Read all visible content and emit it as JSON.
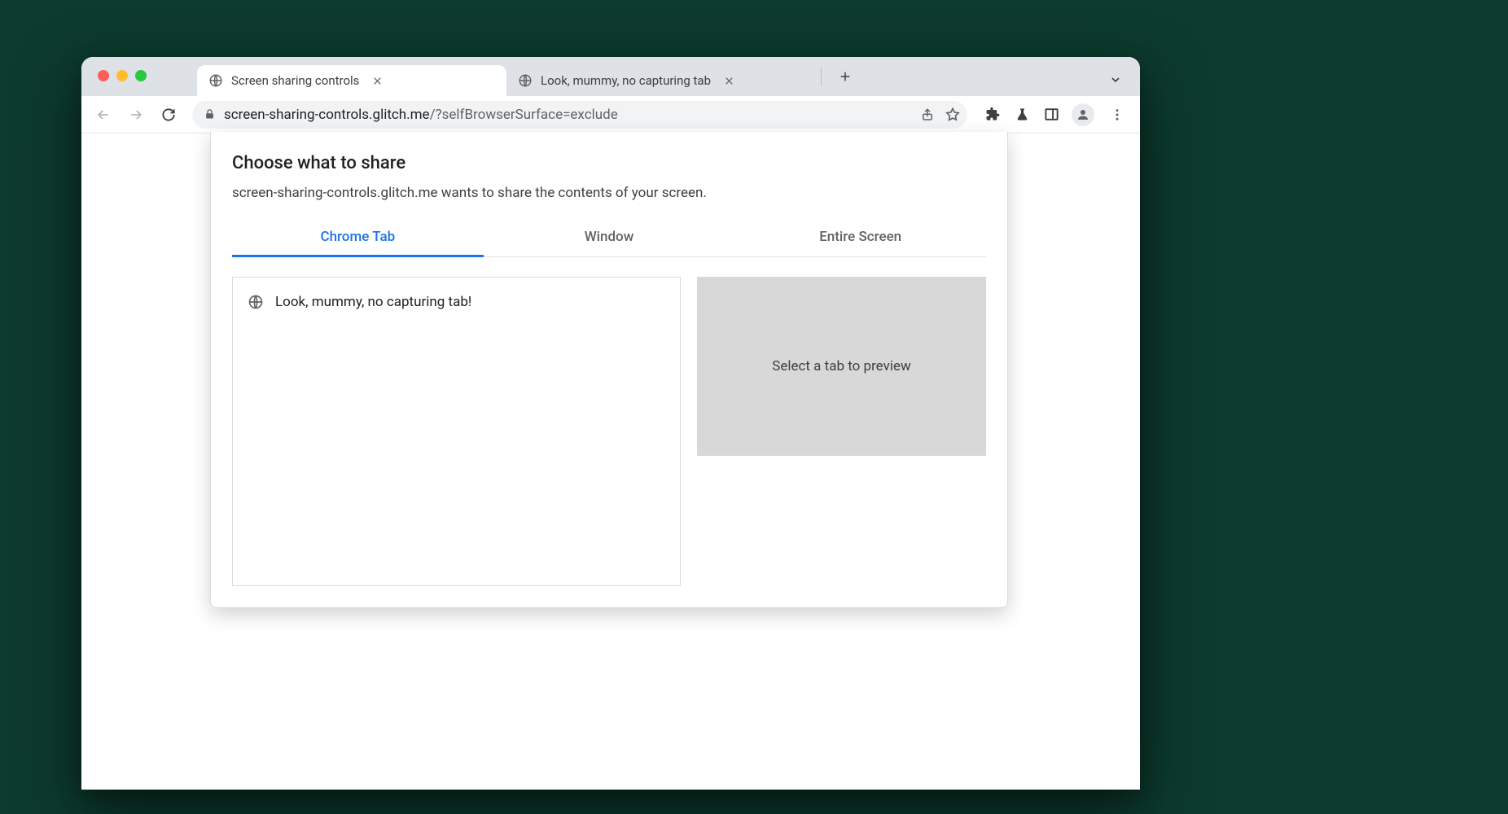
{
  "browser": {
    "tabs": [
      {
        "title": "Screen sharing controls",
        "active": true
      },
      {
        "title": "Look, mummy, no capturing tab",
        "active": false
      }
    ],
    "url_host": "screen-sharing-controls.glitch.me",
    "url_path": "/?selfBrowserSurface=exclude"
  },
  "dialog": {
    "title": "Choose what to share",
    "subtitle": "screen-sharing-controls.glitch.me wants to share the contents of your screen.",
    "tabs": {
      "chrome_tab": "Chrome Tab",
      "window": "Window",
      "entire_screen": "Entire Screen"
    },
    "list_items": [
      {
        "title": "Look, mummy, no capturing tab!"
      }
    ],
    "preview_placeholder": "Select a tab to preview"
  }
}
